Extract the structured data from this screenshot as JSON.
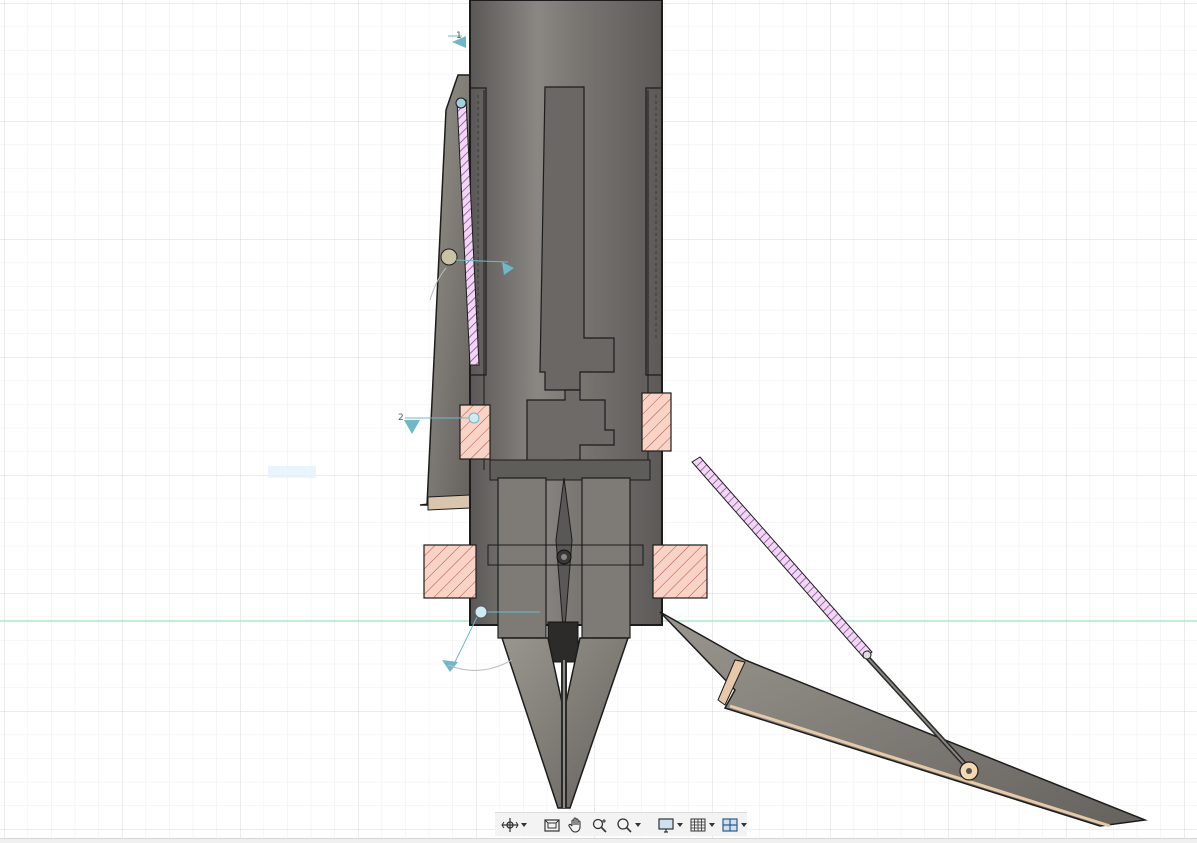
{
  "viewport": {
    "background": "#ffffff",
    "grid_minor_color": "#ececec",
    "grid_major_color": "#d8d8d8",
    "ground_axis_color": "#9be3c0",
    "body_fill": "#6f6c69",
    "fin_fill": "#7d7a76",
    "section_hatch_pink": "#e7b8f0",
    "section_hatch_salmon": "#f5c7b8",
    "joint_marker_color": "#6fb8c8",
    "dimension_labels": [
      "1",
      "2"
    ]
  },
  "toolbar": {
    "items": [
      {
        "name": "orbit",
        "icon": "orbit-icon",
        "has_menu": true
      },
      {
        "name": "look-at",
        "icon": "look-at-icon",
        "has_menu": false
      },
      {
        "name": "pan",
        "icon": "pan-hand-icon",
        "has_menu": false
      },
      {
        "name": "zoom",
        "icon": "zoom-icon",
        "has_menu": false
      },
      {
        "name": "fit",
        "icon": "zoom-window-icon",
        "has_menu": true
      },
      {
        "name": "display-settings",
        "icon": "display-icon",
        "has_menu": true
      },
      {
        "name": "grid-settings",
        "icon": "grid-icon",
        "has_menu": true
      },
      {
        "name": "viewports",
        "icon": "viewports-icon",
        "has_menu": true
      }
    ]
  }
}
